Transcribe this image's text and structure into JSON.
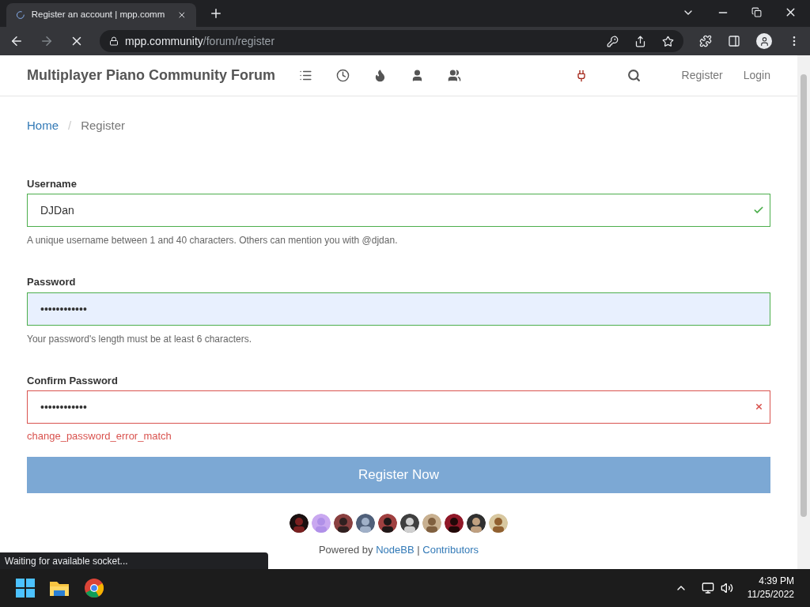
{
  "browser": {
    "tab_title": "Register an account | mpp.comm",
    "url_host": "mpp.community",
    "url_path": "/forum/register",
    "status": "Waiting for available socket..."
  },
  "header": {
    "site_title": "Multiplayer Piano Community Forum",
    "nav_icons": [
      {
        "kind": "list"
      },
      {
        "kind": "clock"
      },
      {
        "kind": "fire"
      },
      {
        "kind": "user"
      },
      {
        "kind": "users"
      }
    ],
    "links": [
      {
        "label": "Register"
      },
      {
        "label": "Login"
      }
    ]
  },
  "breadcrumb_separator": "/",
  "breadcrumb": [
    {
      "label": "Home",
      "current": false
    },
    {
      "label": "Register",
      "current": true
    }
  ],
  "fields": [
    {
      "label": "Username",
      "value": "DJDan",
      "valid": true,
      "autofilled": false,
      "help": "A unique username between 1 and 40 characters. Others can mention you with @djdan."
    },
    {
      "label": "Password",
      "value": "••••••••••••",
      "valid": true,
      "autofilled": true,
      "help": "Your password's length must be at least 6 characters."
    },
    {
      "label": "Confirm Password",
      "value": "••••••••••••",
      "valid": false,
      "autofilled": false,
      "error": "change_password_error_match"
    }
  ],
  "submit": "Register Now",
  "footer": {
    "prefix": "Powered by",
    "link1": "NodeBB",
    "separator": "|",
    "link2": "Contributors"
  },
  "taskbar": {
    "time": "4:39 PM",
    "date": "11/25/2022"
  }
}
